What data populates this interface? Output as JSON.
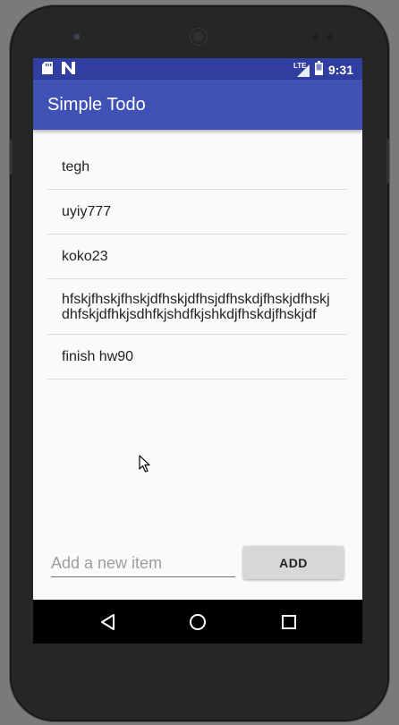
{
  "status_bar": {
    "time": "9:31",
    "network_label": "LTE",
    "icons": [
      "sd-card-icon",
      "n-notification-icon",
      "lte-signal-icon",
      "battery-icon"
    ]
  },
  "app_bar": {
    "title": "Simple Todo"
  },
  "todo_items": [
    {
      "text": "tegh"
    },
    {
      "text": "uyiy777"
    },
    {
      "text": "koko23"
    },
    {
      "text": "hfskjfhskjfhskjdfhskjdfhsjdfhskdjfhskjdfhskjdhfskjdfhkjsdhfkjshdfkjshkdjfhskdjfhskjdf"
    },
    {
      "text": "finish hw90"
    }
  ],
  "input": {
    "placeholder": "Add a new item",
    "value": ""
  },
  "add_button": {
    "label": "ADD"
  },
  "nav_bar": {
    "icons": [
      "back-icon",
      "home-icon",
      "recents-icon"
    ]
  },
  "colors": {
    "primary": "#3f51b5",
    "primary_dark": "#303f9f",
    "background": "#fafafa",
    "button": "#d6d7d7"
  }
}
